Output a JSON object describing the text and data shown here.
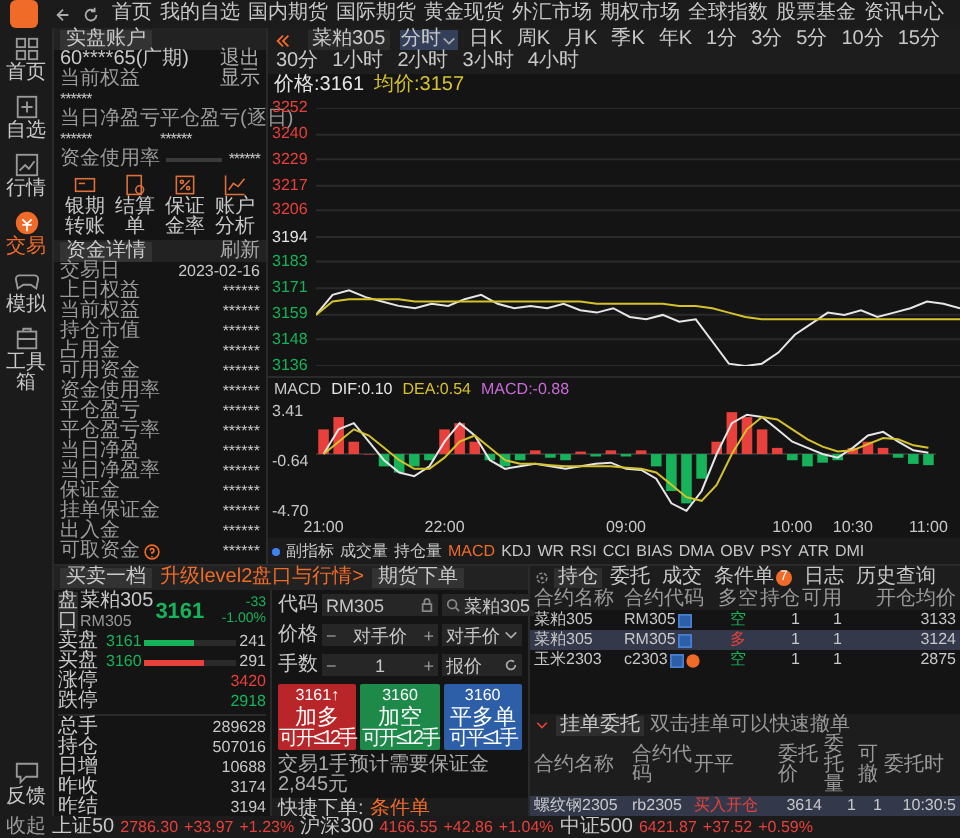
{
  "nav": {
    "items": [
      "首页",
      "我的自选",
      "国内期货",
      "国际期货",
      "黄金现货",
      "外汇市场",
      "期权市场",
      "全球指数",
      "股票基金",
      "资讯中心"
    ]
  },
  "rail": {
    "items": [
      {
        "label": "首页",
        "kind": "home",
        "selected": false
      },
      {
        "label": "自选",
        "kind": "watch",
        "selected": false
      },
      {
        "label": "行情",
        "kind": "market",
        "selected": false
      },
      {
        "label": "交易",
        "kind": "trade",
        "selected": true
      },
      {
        "label": "模拟",
        "kind": "game",
        "selected": false
      },
      {
        "label": "工具箱",
        "kind": "tools",
        "selected": false
      },
      {
        "label": "反馈",
        "kind": "feedback",
        "selected": false
      }
    ]
  },
  "account": {
    "tab": "实盘账户",
    "account_id": "60****65(广期)",
    "logout": "退出",
    "equity_label": "当前权益",
    "show_label": "显示",
    "equity_value": "******",
    "pnl_label": "当日净盈亏",
    "close_pnl_label": "平仓盈亏(逐日)",
    "pnl_value": "******",
    "close_pnl_value": "******",
    "usage_label": "资金使用率",
    "usage_value": "******",
    "shortcuts": [
      {
        "label": "银期转账",
        "kind": "card"
      },
      {
        "label": "结算单",
        "kind": "doc"
      },
      {
        "label": "保证金率",
        "kind": "percent"
      },
      {
        "label": "账户分析",
        "kind": "chart"
      }
    ]
  },
  "funds": {
    "tab": "资金详情",
    "refresh": "刷新",
    "rows": [
      {
        "label": "交易日",
        "value": "2023-02-16",
        "kind": "plain"
      },
      {
        "label": "上日权益",
        "value": "******",
        "kind": "plain"
      },
      {
        "label": "当前权益",
        "value": "******",
        "kind": "plain"
      },
      {
        "label": "持仓市值",
        "value": "******",
        "kind": "plain"
      },
      {
        "label": "占用金",
        "value": "******",
        "kind": "plain"
      },
      {
        "label": "可用资金",
        "value": "******",
        "kind": "plain"
      },
      {
        "label": "资金使用率",
        "value": "******",
        "kind": "plain"
      },
      {
        "label": "平仓盈亏",
        "value": "******",
        "kind": "plain"
      },
      {
        "label": "平仓盈亏率",
        "value": "******",
        "kind": "plain"
      },
      {
        "label": "当日净盈",
        "value": "******",
        "kind": "plain"
      },
      {
        "label": "当日净盈率",
        "value": "******",
        "kind": "plain"
      },
      {
        "label": "保证金",
        "value": "******",
        "kind": "plain"
      },
      {
        "label": "挂单保证金",
        "value": "******",
        "kind": "plain"
      },
      {
        "label": "出入金",
        "value": "******",
        "kind": "plain"
      },
      {
        "label": "可取资金",
        "value": "******",
        "kind": "help"
      }
    ]
  },
  "chart": {
    "symbol": "菜粕305",
    "periods": [
      {
        "label": "分时",
        "kind": "dropdown",
        "selected": true
      },
      {
        "label": "日K",
        "kind": "plain",
        "selected": false
      },
      {
        "label": "周K",
        "kind": "plain",
        "selected": false
      },
      {
        "label": "月K",
        "kind": "plain",
        "selected": false
      },
      {
        "label": "季K",
        "kind": "plain",
        "selected": false
      },
      {
        "label": "年K",
        "kind": "plain",
        "selected": false
      },
      {
        "label": "1分",
        "kind": "plain",
        "selected": false
      },
      {
        "label": "3分",
        "kind": "plain",
        "selected": false
      },
      {
        "label": "5分",
        "kind": "plain",
        "selected": false
      },
      {
        "label": "10分",
        "kind": "plain",
        "selected": false
      },
      {
        "label": "15分",
        "kind": "plain",
        "selected": false
      },
      {
        "label": "30分",
        "kind": "plain",
        "selected": false
      },
      {
        "label": "1小时",
        "kind": "plain",
        "selected": false
      },
      {
        "label": "2小时",
        "kind": "plain",
        "selected": false
      },
      {
        "label": "3小时",
        "kind": "plain",
        "selected": false
      },
      {
        "label": "4小时",
        "kind": "plain",
        "selected": false
      }
    ],
    "price_value": ":3161",
    "avg_value": ":3157",
    "chart_data": {
      "type": "line",
      "ylim": [
        3136,
        3252
      ],
      "grid": true,
      "yticks": [
        3252,
        3240,
        3229,
        3217,
        3206,
        3194,
        3183,
        3171,
        3159,
        3148,
        3136
      ],
      "series": [
        {
          "name": "价格",
          "color": "#e6e6e6",
          "values": [
            3159,
            3168,
            3170,
            3167,
            3165,
            3163,
            3162,
            3164,
            3163,
            3166,
            3168,
            3164,
            3162,
            3163,
            3162,
            3164,
            3161,
            3160,
            3162,
            3158,
            3157,
            3159,
            3156,
            3157,
            3147,
            3137,
            3136,
            3137,
            3142,
            3150,
            3155,
            3160,
            3159,
            3161,
            3158,
            3160,
            3162,
            3165,
            3164,
            3162
          ]
        },
        {
          "name": "均价",
          "color": "#d4c22b",
          "values": [
            3159,
            3165,
            3166,
            3166,
            3166,
            3166,
            3165,
            3165,
            3165,
            3165,
            3165,
            3165,
            3165,
            3165,
            3165,
            3165,
            3165,
            3164,
            3164,
            3164,
            3164,
            3164,
            3163,
            3163,
            3162,
            3160,
            3158,
            3157,
            3157,
            3157,
            3157,
            3157,
            3157,
            3157,
            3157,
            3157,
            3157,
            3157,
            3157,
            3157
          ]
        }
      ]
    }
  },
  "macd": {
    "indicator": "MACD",
    "dif": ":0.10",
    "dea": ":0.54",
    "macd": ":-0.88",
    "chart_data": {
      "type": "bar",
      "ylim": [
        -4.7,
        3.41
      ],
      "yticks": [
        {
          "value": 3.41,
          "label": "3.41"
        },
        {
          "value": -0.64,
          "label": "-0.64"
        },
        {
          "value": -4.7,
          "label": "-4.70"
        }
      ],
      "categories": [
        "21:00",
        null,
        null,
        null,
        null,
        null,
        null,
        null,
        "22:00",
        null,
        null,
        null,
        null,
        null,
        null,
        null,
        null,
        null,
        null,
        null,
        "09:00",
        null,
        null,
        null,
        null,
        null,
        null,
        null,
        null,
        null,
        null,
        "10:00",
        null,
        null,
        null,
        "10:30",
        null,
        null,
        null,
        null,
        "11:00"
      ],
      "series": [
        {
          "name": "MACD",
          "values": [
            2,
            3,
            1,
            0,
            -1,
            -1.5,
            -1,
            -0.5,
            2,
            2.5,
            1,
            -0.5,
            -1,
            -0.5,
            0.3,
            -0.3,
            -0.5,
            0.2,
            -0.2,
            0.3,
            -0.2,
            0.3,
            -1,
            -3,
            -4,
            -2,
            1,
            3.4,
            3,
            2,
            0.5,
            -0.5,
            -1,
            -0.7,
            -0.5,
            0.5,
            1,
            0.5,
            -0.3,
            -0.8,
            -0.9
          ],
          "colors": [
            "#e8403a",
            "#e8403a",
            "#e8403a",
            "#e8403a",
            "#16b35a",
            "#16b35a",
            "#16b35a",
            "#16b35a",
            "#e8403a",
            "#e8403a",
            "#e8403a",
            "#16b35a",
            "#16b35a",
            "#16b35a",
            "#e8403a",
            "#16b35a",
            "#16b35a",
            "#e8403a",
            "#16b35a",
            "#e8403a",
            "#16b35a",
            "#e8403a",
            "#16b35a",
            "#16b35a",
            "#16b35a",
            "#16b35a",
            "#e8403a",
            "#e8403a",
            "#e8403a",
            "#e8403a",
            "#e8403a",
            "#16b35a",
            "#16b35a",
            "#16b35a",
            "#16b35a",
            "#e8403a",
            "#e8403a",
            "#e8403a",
            "#16b35a",
            "#16b35a",
            "#16b35a"
          ]
        },
        {
          "name": "DIF",
          "type": "line",
          "color": "#e6e6e6",
          "values": [
            0,
            2,
            2.5,
            1,
            -0.5,
            -1.5,
            -1.8,
            -1,
            1,
            2.5,
            1.5,
            -0.5,
            -1.2,
            -1,
            -0.8,
            -1,
            -1.2,
            -1,
            -0.8,
            -0.7,
            -1.2,
            -1.3,
            -2,
            -4,
            -4.6,
            -3,
            0,
            2.5,
            3.2,
            3,
            2,
            1,
            0.5,
            0,
            -0.3,
            0.5,
            1.5,
            1.8,
            1,
            0.3,
            0.1
          ]
        },
        {
          "name": "DEA",
          "type": "line",
          "color": "#d4c22b",
          "values": [
            0,
            1,
            2,
            1.5,
            0.5,
            -0.5,
            -1.2,
            -1.2,
            -0.3,
            1,
            1.5,
            0.5,
            -0.5,
            -0.8,
            -0.8,
            -0.9,
            -1,
            -1,
            -1,
            -1,
            -1.1,
            -1.2,
            -1.5,
            -2.5,
            -3.5,
            -3.8,
            -2.5,
            0,
            2,
            3,
            2.8,
            2,
            1.2,
            0.6,
            0.2,
            0.3,
            0.8,
            1.3,
            1.2,
            0.7,
            0.5
          ]
        }
      ]
    }
  },
  "indicators": [
    {
      "label": "副指标",
      "selected": false
    },
    {
      "label": "成交量",
      "selected": false
    },
    {
      "label": "持仓量",
      "selected": false
    },
    {
      "label": "MACD",
      "selected": true
    },
    {
      "label": "KDJ",
      "selected": false
    },
    {
      "label": "WR",
      "selected": false
    },
    {
      "label": "RSI",
      "selected": false
    },
    {
      "label": "CCI",
      "selected": false
    },
    {
      "label": "BIAS",
      "selected": false
    },
    {
      "label": "DMA",
      "selected": false
    },
    {
      "label": "OBV",
      "selected": false
    },
    {
      "label": "PSY",
      "selected": false
    },
    {
      "label": "ATR",
      "selected": false
    },
    {
      "label": "DMI",
      "selected": false
    }
  ],
  "quote": {
    "tab": "买卖一档",
    "upgrade_link": "升级level2盘口与行情>",
    "side_tag": "盘口",
    "symbol": "菜粕305",
    "code": "RM305",
    "price": "3161",
    "change": "-33",
    "change_pct": "-1.00%",
    "levels": [
      {
        "label": "卖盘",
        "price": "3161",
        "volume": "241",
        "level": 0.55,
        "color": "#16b35a"
      },
      {
        "label": "买盘",
        "price": "3160",
        "volume": "291",
        "level": 0.65,
        "color": "#e8403a"
      }
    ],
    "limits": [
      {
        "label": "涨停",
        "value": "3420",
        "kind": "up"
      },
      {
        "label": "跌停",
        "value": "2918",
        "kind": "down"
      }
    ],
    "stats": [
      {
        "label": "总手",
        "value": "289628"
      },
      {
        "label": "持仓",
        "value": "507016"
      },
      {
        "label": "日增",
        "value": "10688"
      },
      {
        "label": "昨收",
        "value": "3174"
      },
      {
        "label": "昨结",
        "value": "3194"
      }
    ]
  },
  "order": {
    "tab": "期货下单",
    "code_label": "代码",
    "code": "RM305",
    "search_value": "菜粕305",
    "price_label": "价格",
    "price_minus": "−",
    "price_mode": "对手价",
    "price_plus": "+",
    "price_select": "对手价",
    "qty_label": "手数",
    "qty_minus": "−",
    "qty": "1",
    "qty_plus": "+",
    "quote_button": "报价",
    "buttons": [
      {
        "kind": "buy",
        "price": "3161↑",
        "label": "加多",
        "sub": "可开≤12手"
      },
      {
        "kind": "sell",
        "price": "3160",
        "label": "加空",
        "sub": "可开≤12手"
      },
      {
        "kind": "close",
        "price": "3160",
        "label": "平多单",
        "sub": "可平≤1手"
      }
    ],
    "margin_note": "交易1手预计需要保证金2,845元",
    "quick_label": "快捷下单:",
    "quick_link": "条件单"
  },
  "positions": {
    "tabs": [
      {
        "label": "持仓",
        "selected": true
      },
      {
        "label": "委托",
        "selected": false
      },
      {
        "label": "成交",
        "selected": false
      },
      {
        "label": "条件单",
        "badge": "7",
        "selected": false
      },
      {
        "label": "日志",
        "selected": false
      },
      {
        "label": "历史查询",
        "selected": false
      }
    ],
    "columns": [
      "合约名称",
      "合约代码",
      "多空",
      "持仓",
      "可用",
      "开仓均价"
    ],
    "rows": [
      {
        "name": "菜粕305",
        "code": "RM305",
        "side": "空",
        "long": false,
        "hold": "1",
        "avail": "1",
        "avg": "3133",
        "warning": false,
        "selected": false
      },
      {
        "name": "菜粕305",
        "code": "RM305",
        "side": "多",
        "long": true,
        "hold": "1",
        "avail": "1",
        "avg": "3124",
        "warning": false,
        "selected": true
      },
      {
        "name": "玉米2303",
        "code": "c2303",
        "side": "空",
        "long": false,
        "hold": "1",
        "avail": "1",
        "avg": "2875",
        "warning": true,
        "selected": false
      }
    ]
  },
  "pending": {
    "tab": "挂单委托",
    "hint": "双击挂单可以快速撤单",
    "columns": [
      "合约名称",
      "合约代码",
      "开平",
      "委托价",
      "委托量",
      "可撤",
      "委托时"
    ],
    "rows": [
      {
        "name": "螺纹钢2305",
        "code": "rb2305",
        "action": "买入开仓",
        "price": "3614",
        "qty": "1",
        "cancelable": "1",
        "time": "10:30:5",
        "selected": true
      }
    ]
  },
  "status": {
    "collapse": "收起",
    "indices": [
      {
        "name": "上证50",
        "value": "2786.30",
        "change": "+33.97",
        "pct": "+1.23%"
      },
      {
        "name": "沪深300",
        "value": "4166.55",
        "change": "+42.86",
        "pct": "+1.04%"
      },
      {
        "name": "中证500",
        "value": "6421.87",
        "change": "+37.52",
        "pct": "+0.59%"
      }
    ]
  }
}
